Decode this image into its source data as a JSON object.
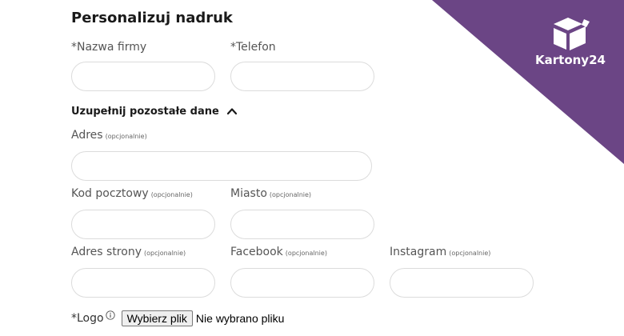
{
  "form": {
    "title": "Personalizuj nadruk",
    "company": {
      "label": "*Nazwa firmy",
      "value": ""
    },
    "phone": {
      "label": "*Telefon",
      "value": ""
    },
    "more_toggle": "Uzupełnij pozostałe dane",
    "address": {
      "label": "Adres",
      "optional": "(opcjonalnie)",
      "value": ""
    },
    "postal": {
      "label": "Kod pocztowy",
      "optional": "(opcjonalnie)",
      "value": ""
    },
    "city": {
      "label": "Miasto",
      "optional": "(opcjonalnie)",
      "value": ""
    },
    "website": {
      "label": "Adres strony",
      "optional": "(opcjonalnie)",
      "value": ""
    },
    "facebook": {
      "label": "Facebook",
      "optional": "(opcjonalnie)",
      "value": ""
    },
    "instagram": {
      "label": "Instagram",
      "optional": "(opcjonalnie)",
      "value": ""
    },
    "logo": {
      "label": "*Logo",
      "button": "Wybierz plik",
      "status": "Nie wybrano pliku"
    }
  },
  "brand": {
    "name": "Kartony24",
    "color": "#6b4585"
  },
  "icons": {
    "toggle": "chevron-up-icon",
    "info": "info-icon",
    "brand": "box-icon"
  }
}
